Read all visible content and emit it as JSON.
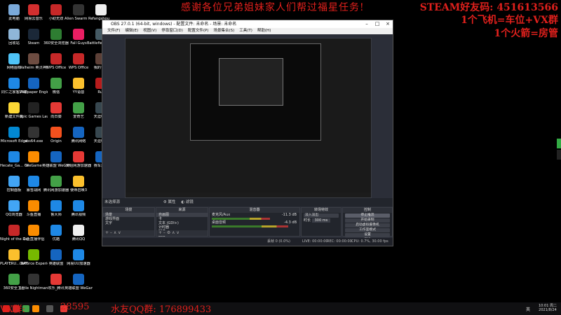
{
  "overlays": {
    "top_banner": "感谢各位兄弟姐妹家人们帮过福星任务!",
    "steam_line1": "STEAM好友码: 451613566",
    "steam_line2": "1个飞机=车位+VX群",
    "steam_line3": "1个火箭=房管",
    "bottom_left": "VX群: ",
    "bottom_partial": "28595",
    "bottom_qq": "水友QQ群: 176899433"
  },
  "desktop_icons": [
    {
      "label": "此电脑",
      "color": "#7aa9d9"
    },
    {
      "label": "网易云音乐",
      "color": "#d32f2f"
    },
    {
      "label": "小助无双",
      "color": "#c62828"
    },
    {
      "label": "Alien Swarm Reactive D...",
      "color": "#333"
    },
    {
      "label": "fangshou",
      "color": "#eee"
    },
    {
      "label": "回收站",
      "color": "#8fb6d8"
    },
    {
      "label": "Steam",
      "color": "#1b2838"
    },
    {
      "label": "360安全浏览器",
      "color": "#2e7d32"
    },
    {
      "label": "Fall Guys",
      "color": "#e91e63"
    },
    {
      "label": "Battlefield Games",
      "color": "#455a64"
    },
    {
      "label": "网络图标",
      "color": "#4fc3f7"
    },
    {
      "label": "Valheim 英灵神殿",
      "color": "#6d4c41"
    },
    {
      "label": "WPS Office",
      "color": "#c62828"
    },
    {
      "label": "WPS Office",
      "color": "#c62828"
    },
    {
      "label": "我的世界",
      "color": "#5d4037"
    },
    {
      "label": "同仁之家客户端",
      "color": "#1e88e5"
    },
    {
      "label": "Wallpaper Engine:...",
      "color": "#1565c0"
    },
    {
      "label": "微信",
      "color": "#43a047"
    },
    {
      "label": "YY语音",
      "color": "#fbc02d"
    },
    {
      "label": "Rus",
      "color": "#b71c1c"
    },
    {
      "label": "新建文件夹",
      "color": "#fdd835"
    },
    {
      "label": "Epic Games Launcher",
      "color": "#222"
    },
    {
      "label": "向日葵",
      "color": "#e53935"
    },
    {
      "label": "爱奇艺",
      "color": "#43a047"
    },
    {
      "label": "天涯明月",
      "color": "#37474f"
    },
    {
      "label": "Microsoft Edge",
      "color": "#0288d1"
    },
    {
      "label": "obs64.exe",
      "color": "#333"
    },
    {
      "label": "Origin",
      "color": "#f4511e"
    },
    {
      "label": "腾讯网络",
      "color": "#1565c0"
    },
    {
      "label": "天涯明月",
      "color": "#37474f"
    },
    {
      "label": "Hecate_Ga... Center 2.0",
      "color": "#1e88e5"
    },
    {
      "label": "WeGame",
      "color": "#fb8c00"
    },
    {
      "label": "英雄联盟 WeGame版",
      "color": "#1565c0"
    },
    {
      "label": "开始网游加速器",
      "color": "#e53935"
    },
    {
      "label": "赛车游戏",
      "color": "#1565c0"
    },
    {
      "label": "控制面板",
      "color": "#42a5f5"
    },
    {
      "label": "暴雪战网",
      "color": "#1e88e5"
    },
    {
      "label": "腾讯网游加速器",
      "color": "#43a047"
    },
    {
      "label": "使命召唤3",
      "color": "#fbc02d"
    },
    {
      "label": "",
      "color": "#000"
    },
    {
      "label": "QQ浏览器",
      "color": "#42a5f5"
    },
    {
      "label": "斗鱼直播",
      "color": "#fb8c00"
    },
    {
      "label": "鲁大师",
      "color": "#1e88e5"
    },
    {
      "label": "腾讯视频",
      "color": "#1e88e5"
    },
    {
      "label": "",
      "color": "#000"
    },
    {
      "label": "Night of the Dead",
      "color": "#c62828"
    },
    {
      "label": "斗鱼直播伴侣",
      "color": "#fb8c00"
    },
    {
      "label": "优酷",
      "color": "#1e88e5"
    },
    {
      "label": "腾讯QQ",
      "color": "#eee"
    },
    {
      "label": "",
      "color": "#000"
    },
    {
      "label": "PLAYERU... BATTLEGR...",
      "color": "#fbc02d"
    },
    {
      "label": "GeForce Experience",
      "color": "#76b900"
    },
    {
      "label": "英雄联盟",
      "color": "#1565c0"
    },
    {
      "label": "网易UU加速器",
      "color": "#1e88e5"
    },
    {
      "label": "",
      "color": "#000"
    },
    {
      "label": "360安全卫士",
      "color": "#43a047"
    },
    {
      "label": "Little Nightmares",
      "color": "#333"
    },
    {
      "label": "欢乐_腾讯",
      "color": "#e53935"
    },
    {
      "label": "英雄联盟 WeGame版",
      "color": "#1565c0"
    },
    {
      "label": "",
      "color": "#000"
    }
  ],
  "obs": {
    "title": "OBS 27.0.1 (64-bit, windows) - 配置文件: 未命名 - 场景: 未命名",
    "menu": [
      "文件(F)",
      "编辑(E)",
      "视图(V)",
      "停靠窗口(D)",
      "配置文件(P)",
      "场景集合(S)",
      "工具(T)",
      "帮助(H)"
    ],
    "scene_bar": {
      "label": "未选择源",
      "props": "属性",
      "filters": "滤镜"
    },
    "docks": {
      "scenes": {
        "title": "场景",
        "items": [
          "场景",
          "游戏界面",
          "文字"
        ]
      },
      "sources": {
        "title": "来源",
        "items": [
          "自画图",
          "卡",
          "文本 (GDI+)",
          "计时器",
          "解说",
          "LOL"
        ]
      },
      "mixer": {
        "title": "混音器",
        "channels": [
          {
            "name": "麦克风/Aux",
            "db": "-11.3 dB",
            "level": 0.65
          },
          {
            "name": "桌面音频",
            "db": "-4.3 dB",
            "level": 0.85
          }
        ]
      },
      "transitions": {
        "title": "转场特效",
        "type": "淡入淡出",
        "duration_label": "时长",
        "duration": "300 ms"
      },
      "controls": {
        "title": "控制",
        "buttons": [
          "停止推流",
          "开始录制",
          "启动虚拟摄像机",
          "工作室模式",
          "设置",
          "退出"
        ]
      }
    },
    "status": {
      "drop": "丢帧 0 (0.0%)",
      "live": "LIVE: 00:00:00",
      "rec": "REC: 00:00:00",
      "cpu": "CPU: 0.7%, 30.00 fps"
    }
  },
  "taskbar": {
    "time": "10:01 周二",
    "date": "2021/8/24",
    "lang": "英"
  }
}
